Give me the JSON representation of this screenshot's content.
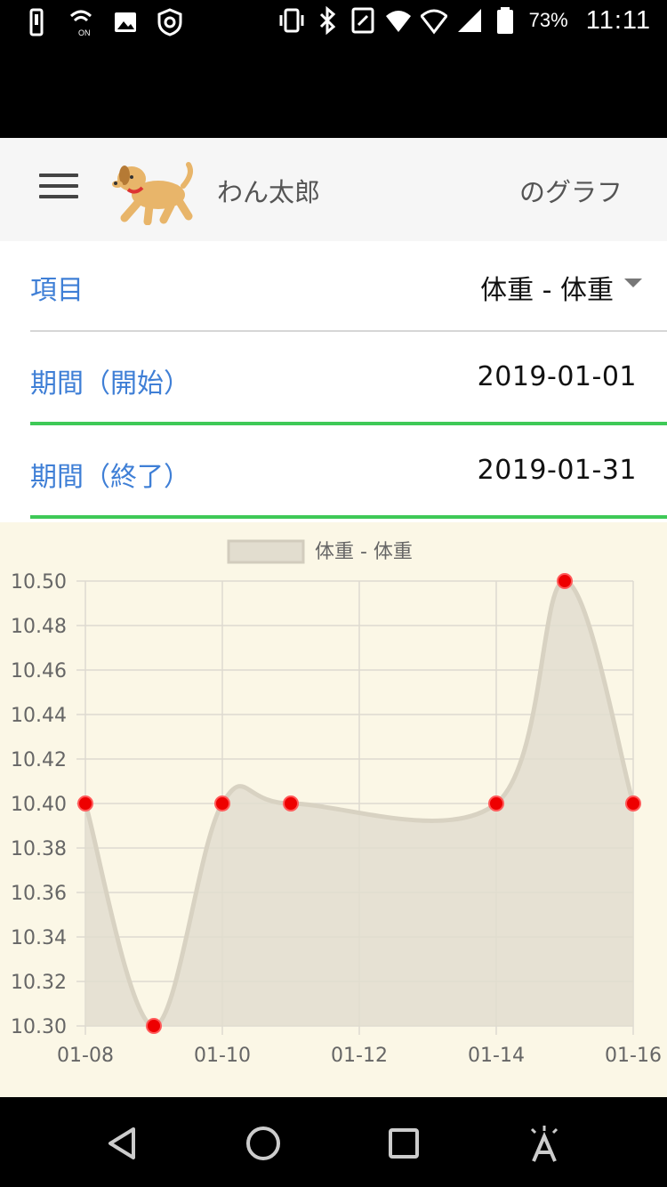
{
  "status_bar": {
    "battery_percent": "73%",
    "time": "11:11"
  },
  "toolbar": {
    "pet_name": "わん太郎",
    "graph_label": "のグラフ"
  },
  "form": {
    "item": {
      "label": "項目",
      "value": "体重 - 体重"
    },
    "period_start": {
      "label": "期間（開始）",
      "value": "2019-01-01"
    },
    "period_end": {
      "label": "期間（終了）",
      "value": "2019-01-31"
    }
  },
  "colors": {
    "label_blue": "#3f7fd6",
    "accent_green": "#3ec957",
    "chart_bg": "#fbf7e6",
    "point_red": "#ee0000",
    "area_fill": "#e2ddcf"
  },
  "chart_data": {
    "type": "area",
    "series": [
      {
        "name": "体重 - 体重",
        "x": [
          "01-08",
          "01-09",
          "01-10",
          "01-11",
          "01-14",
          "01-15",
          "01-16"
        ],
        "y": [
          10.4,
          10.3,
          10.4,
          10.4,
          10.4,
          10.5,
          10.4
        ]
      }
    ],
    "x_ticks": [
      "01-08",
      "01-10",
      "01-12",
      "01-14",
      "01-16"
    ],
    "xlim": [
      "01-08",
      "01-16"
    ],
    "ylim": [
      10.3,
      10.5
    ],
    "y_ticks": [
      "10.50",
      "10.48",
      "10.46",
      "10.44",
      "10.42",
      "10.40",
      "10.38",
      "10.36",
      "10.34",
      "10.32",
      "10.30"
    ],
    "legend_position": "top",
    "grid": true,
    "smooth": true
  }
}
